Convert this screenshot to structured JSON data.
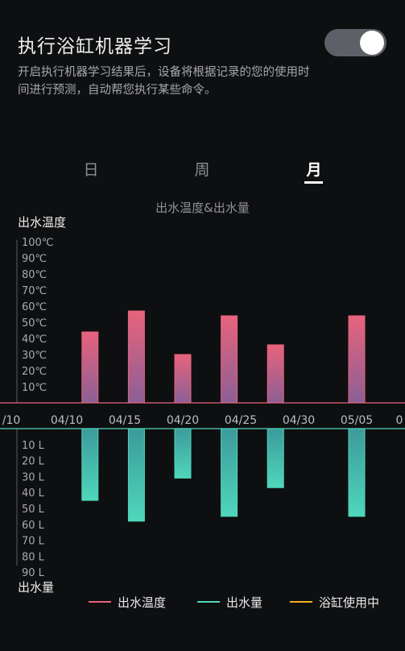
{
  "header": {
    "title": "执行浴缸机器学习",
    "description": "开启执行机器学习结果后，设备将根据记录的您的使用时间进行预测，自动帮您执行某些命令。",
    "toggle_on": true
  },
  "tabs": [
    {
      "label": "日",
      "active": false
    },
    {
      "label": "周",
      "active": false
    },
    {
      "label": "月",
      "active": true
    }
  ],
  "chart": {
    "title": "出水温度&出水量",
    "top_axis_title": "出水温度",
    "bottom_axis_title": "出水量",
    "legend": {
      "temperature": "出水温度",
      "volume": "出水量",
      "in_use": "浴缸使用中"
    }
  },
  "colors": {
    "temperature": "#e8637c",
    "volume": "#4fd7bb",
    "in_use": "#f2b01e",
    "toggle_bg": "#5d6066"
  },
  "chart_data": {
    "type": "bar",
    "x_tick_labels": [
      "/10",
      "04/10",
      "04/15",
      "04/20",
      "04/25",
      "04/30",
      "05/05",
      "0"
    ],
    "temperature": {
      "name": "出水温度",
      "unit": "℃",
      "tick_labels": [
        "100℃",
        "90℃",
        "80℃",
        "70℃",
        "60℃",
        "50℃",
        "40℃",
        "30℃",
        "20℃",
        "10℃"
      ],
      "ylim": [
        0,
        100
      ],
      "points": [
        {
          "x": "04/12",
          "value": 44
        },
        {
          "x": "04/16",
          "value": 57
        },
        {
          "x": "04/20",
          "value": 30
        },
        {
          "x": "04/24",
          "value": 54
        },
        {
          "x": "04/28",
          "value": 36
        },
        {
          "x": "05/05",
          "value": 54
        }
      ]
    },
    "volume": {
      "name": "出水量",
      "unit": "L",
      "tick_labels": [
        "10 L",
        "20 L",
        "30 L",
        "40 L",
        "50 L",
        "60 L",
        "70 L",
        "80 L",
        "90 L"
      ],
      "ylim": [
        0,
        90
      ],
      "points": [
        {
          "x": "04/12",
          "value": 45
        },
        {
          "x": "04/16",
          "value": 58
        },
        {
          "x": "04/20",
          "value": 31
        },
        {
          "x": "04/24",
          "value": 55
        },
        {
          "x": "04/28",
          "value": 37
        },
        {
          "x": "05/05",
          "value": 55
        }
      ]
    }
  }
}
